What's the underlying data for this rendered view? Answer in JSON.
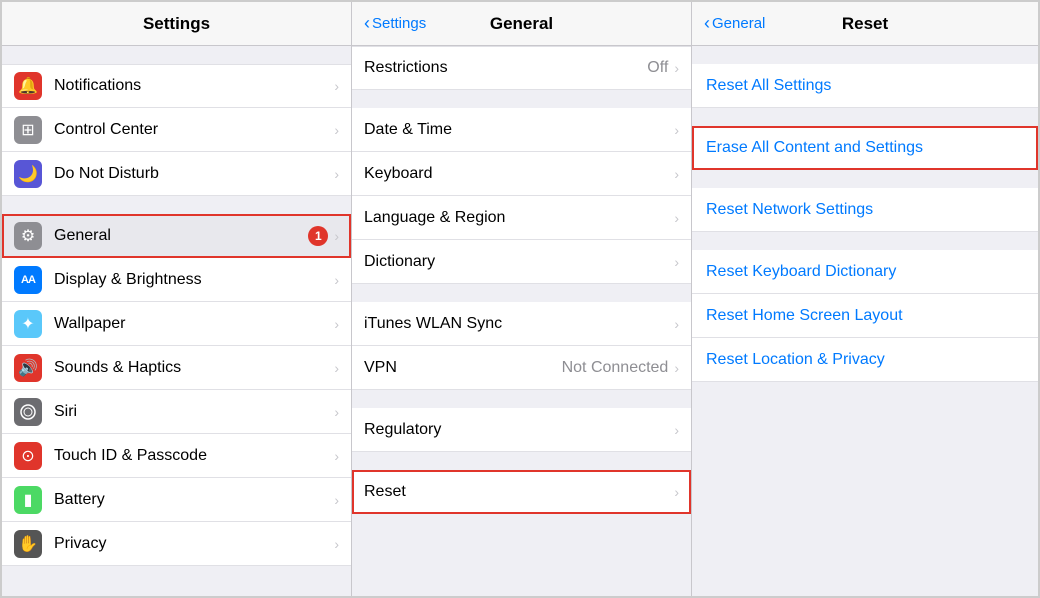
{
  "columns": {
    "settings": {
      "title": "Settings",
      "items": [
        {
          "id": "notifications",
          "label": "Notifications",
          "icon": "🔔",
          "iconClass": "icon-notifications",
          "badge": null
        },
        {
          "id": "control-center",
          "label": "Control Center",
          "icon": "⊞",
          "iconClass": "icon-control-center",
          "badge": null
        },
        {
          "id": "do-not-disturb",
          "label": "Do Not Disturb",
          "icon": "🌙",
          "iconClass": "icon-do-not-disturb",
          "badge": null
        },
        {
          "id": "general",
          "label": "General",
          "icon": "⚙",
          "iconClass": "icon-general",
          "badge": "1",
          "highlighted": true
        },
        {
          "id": "display",
          "label": "Display & Brightness",
          "icon": "AA",
          "iconClass": "icon-display",
          "badge": null
        },
        {
          "id": "wallpaper",
          "label": "Wallpaper",
          "icon": "✦",
          "iconClass": "icon-wallpaper",
          "badge": null
        },
        {
          "id": "sounds",
          "label": "Sounds & Haptics",
          "icon": "🔊",
          "iconClass": "icon-sounds",
          "badge": null
        },
        {
          "id": "siri",
          "label": "Siri",
          "icon": "◎",
          "iconClass": "icon-siri",
          "badge": null
        },
        {
          "id": "touch-id",
          "label": "Touch ID & Passcode",
          "icon": "●",
          "iconClass": "icon-touch-id",
          "badge": null
        },
        {
          "id": "battery",
          "label": "Battery",
          "icon": "▮",
          "iconClass": "icon-battery",
          "badge": null
        },
        {
          "id": "privacy",
          "label": "Privacy",
          "icon": "✋",
          "iconClass": "icon-privacy",
          "badge": null
        }
      ]
    },
    "general": {
      "back_label": "Settings",
      "title": "General",
      "groups": [
        {
          "items": [
            {
              "id": "restrictions",
              "label": "Restrictions",
              "value": "Off",
              "hasChevron": true
            }
          ]
        },
        {
          "items": [
            {
              "id": "date-time",
              "label": "Date & Time",
              "value": "",
              "hasChevron": true
            },
            {
              "id": "keyboard",
              "label": "Keyboard",
              "value": "",
              "hasChevron": true
            },
            {
              "id": "language-region",
              "label": "Language & Region",
              "value": "",
              "hasChevron": true
            },
            {
              "id": "dictionary",
              "label": "Dictionary",
              "value": "",
              "hasChevron": true
            }
          ]
        },
        {
          "items": [
            {
              "id": "itunes-wlan",
              "label": "iTunes WLAN Sync",
              "value": "",
              "hasChevron": true
            },
            {
              "id": "vpn",
              "label": "VPN",
              "value": "Not Connected",
              "hasChevron": true
            }
          ]
        },
        {
          "items": [
            {
              "id": "regulatory",
              "label": "Regulatory",
              "value": "",
              "hasChevron": true
            }
          ]
        },
        {
          "items": [
            {
              "id": "reset",
              "label": "Reset",
              "value": "",
              "hasChevron": true,
              "highlighted": true
            }
          ]
        }
      ]
    },
    "reset": {
      "back_label": "General",
      "title": "Reset",
      "groups": [
        {
          "items": [
            {
              "id": "reset-all-settings",
              "label": "Reset All Settings"
            }
          ]
        },
        {
          "items": [
            {
              "id": "erase-all",
              "label": "Erase All Content and Settings",
              "highlighted": true
            }
          ]
        },
        {
          "items": [
            {
              "id": "reset-network",
              "label": "Reset Network Settings"
            }
          ]
        },
        {
          "items": [
            {
              "id": "reset-keyboard",
              "label": "Reset Keyboard Dictionary"
            },
            {
              "id": "reset-home-screen",
              "label": "Reset Home Screen Layout"
            },
            {
              "id": "reset-location",
              "label": "Reset Location & Privacy"
            }
          ]
        }
      ]
    }
  }
}
